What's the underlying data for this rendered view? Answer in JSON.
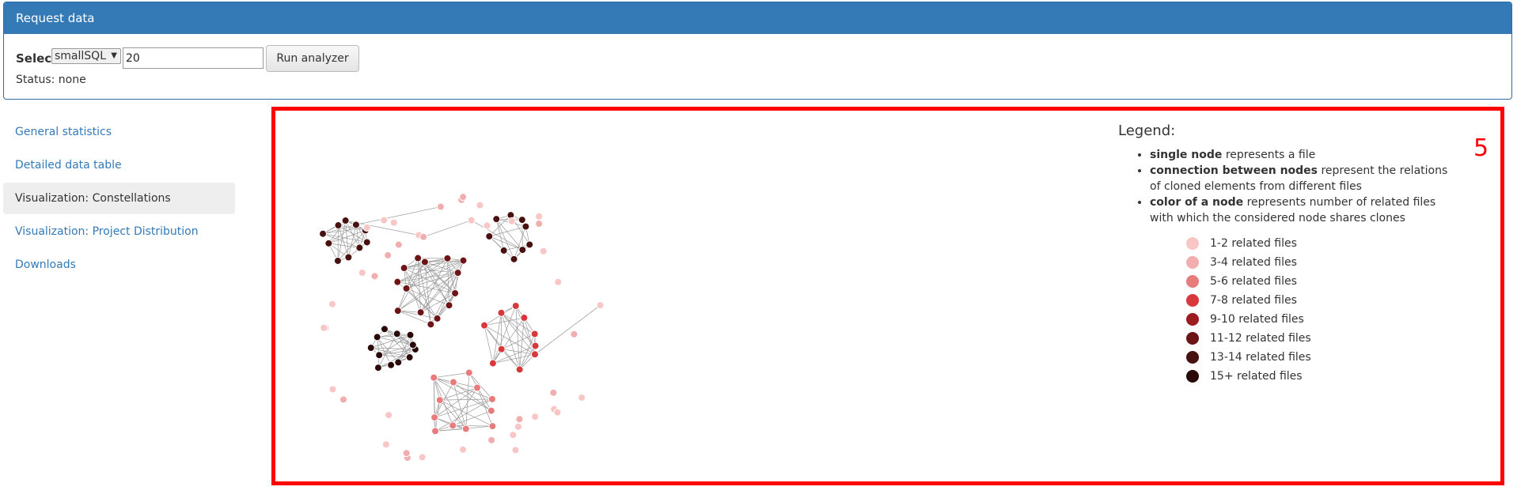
{
  "request_panel": {
    "title": "Request data",
    "select_label": "Select",
    "project_selected": "smallSQL",
    "threshold_value": "20",
    "run_button": "Run analyzer",
    "status": "Status: none"
  },
  "nav": {
    "items": [
      {
        "label": "General statistics",
        "active": false
      },
      {
        "label": "Detailed data table",
        "active": false
      },
      {
        "label": "Visualization: Constellations",
        "active": true
      },
      {
        "label": "Visualization: Project Distribution",
        "active": false
      },
      {
        "label": "Downloads",
        "active": false
      }
    ]
  },
  "annotation_marker": "5",
  "legend": {
    "title": "Legend:",
    "items": [
      {
        "bold": "single node",
        "text": " represents a file"
      },
      {
        "bold": "connection between nodes",
        "text": " represent the relations of cloned elements from different files"
      },
      {
        "bold": "color of a node",
        "text": " represents number of related files with which the considered node shares clones"
      }
    ],
    "swatches": [
      {
        "label": "1-2 related files",
        "color": "#f9c6c6"
      },
      {
        "label": "3-4 related files",
        "color": "#f2aeae"
      },
      {
        "label": "5-6 related files",
        "color": "#e87b7b"
      },
      {
        "label": "7-8 related files",
        "color": "#d8373b"
      },
      {
        "label": "9-10 related files",
        "color": "#9c1c20"
      },
      {
        "label": "11-12 related files",
        "color": "#6c1416"
      },
      {
        "label": "13-14 related files",
        "color": "#48100f"
      },
      {
        "label": "15+ related files",
        "color": "#2a0a08"
      }
    ]
  }
}
